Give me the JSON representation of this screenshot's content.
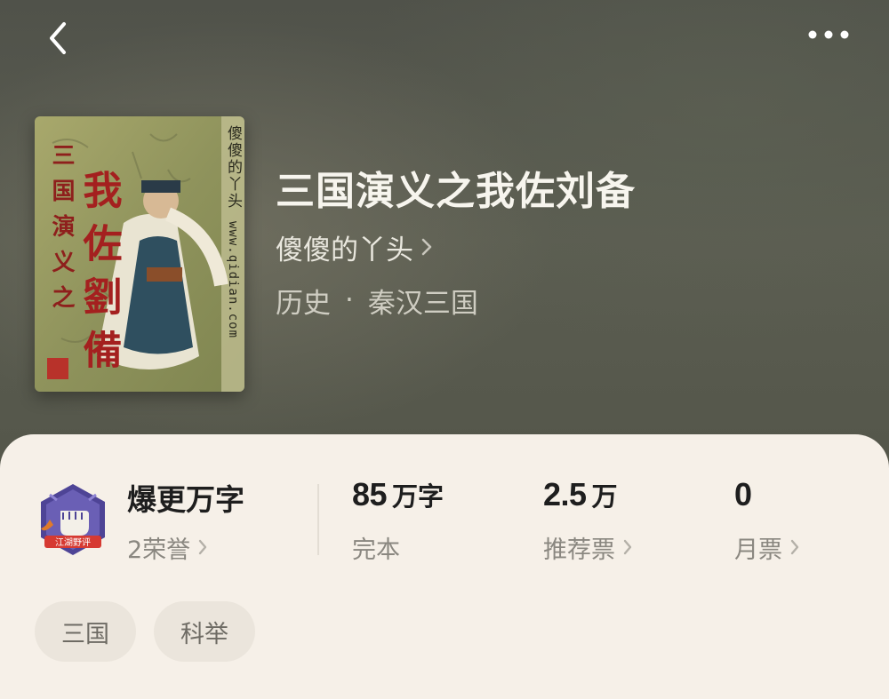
{
  "nav": {
    "back_icon": "chevron-left-icon",
    "more_icon": "more-horizontal-icon"
  },
  "book": {
    "title": "三国演义之我佐刘备",
    "author": "傻傻的丫头",
    "category": "历史",
    "separator": "·",
    "subcategory": "秦汉三国",
    "cover": {
      "title_vertical": "三国演义之",
      "title_big": "我佐劉備",
      "author_vertical": "傻傻的丫头",
      "site_vertical": "www.qidian.com"
    }
  },
  "honor": {
    "badge_icon": "fist-shield-badge-icon",
    "badge_text": "江湖野评",
    "title": "爆更万字",
    "count_label": "2荣誉"
  },
  "stats": {
    "words": {
      "value": "85",
      "unit": "万字",
      "label": "完本"
    },
    "recommend": {
      "value": "2.5",
      "unit": "万",
      "label": "推荐票"
    },
    "monthly": {
      "value": "0",
      "unit": "",
      "label": "月票"
    }
  },
  "tags": [
    "三国",
    "科举"
  ],
  "colors": {
    "header_bg": "#55574a",
    "panel_bg": "#f6f0e8",
    "title_text": "#f7f5ee",
    "tag_bg": "#ebe5dc",
    "badge_purple": "#5a4e9e",
    "badge_red": "#d63a32"
  }
}
